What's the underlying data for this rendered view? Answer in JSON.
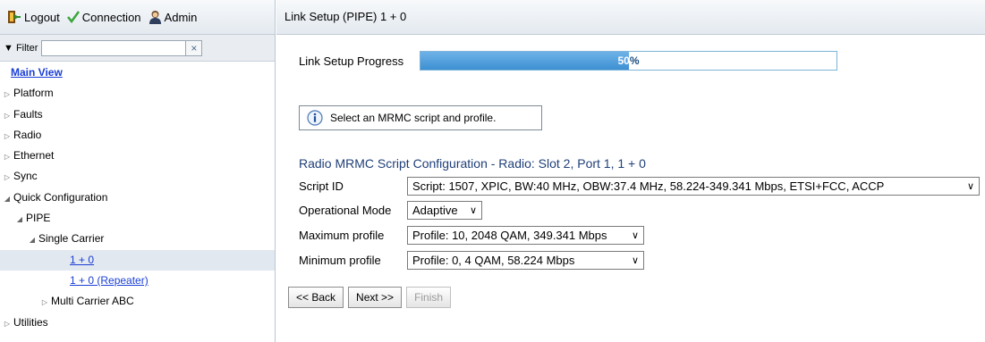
{
  "topbar": {
    "logout_label": "Logout",
    "connection_label": "Connection",
    "admin_label": "Admin"
  },
  "filter": {
    "label": "▼ Filter",
    "value": "",
    "clear_symbol": "×"
  },
  "tree": [
    {
      "label": "Main View",
      "type": "mainview"
    },
    {
      "label": "Platform",
      "arrow": "▷"
    },
    {
      "label": "Faults",
      "arrow": "▷"
    },
    {
      "label": "Radio",
      "arrow": "▷"
    },
    {
      "label": "Ethernet",
      "arrow": "▷"
    },
    {
      "label": "Sync",
      "arrow": "▷"
    },
    {
      "label": "Quick Configuration",
      "arrow": "◢"
    },
    {
      "label": "PIPE",
      "arrow": "◢"
    },
    {
      "label": "Single Carrier",
      "arrow": "◢"
    },
    {
      "label": "1 + 0",
      "type": "link",
      "selected": true
    },
    {
      "label": "1 + 0 (Repeater)",
      "type": "link"
    },
    {
      "label": "Multi Carrier ABC",
      "arrow": "▷"
    },
    {
      "label": "Utilities",
      "arrow": "▷"
    }
  ],
  "header": {
    "title": "Link Setup (PIPE) 1 + 0"
  },
  "progress": {
    "label": "Link Setup Progress",
    "value": 0.5,
    "text_number": "50",
    "text_unit": "%"
  },
  "info": {
    "message": "Select an MRMC script and profile."
  },
  "section": {
    "title": "Radio MRMC Script Configuration - Radio: Slot 2, Port 1, 1 + 0"
  },
  "form": {
    "script_id_label": "Script ID",
    "script_id_value": "Script: 1507, XPIC, BW:40 MHz, OBW:37.4 MHz, 58.224-349.341 Mbps, ETSI+FCC, ACCP",
    "operational_mode_label": "Operational Mode",
    "operational_mode_value": "Adaptive",
    "max_profile_label": "Maximum profile",
    "max_profile_value": "Profile: 10, 2048 QAM, 349.341 Mbps",
    "min_profile_label": "Minimum profile",
    "min_profile_value": "Profile: 0, 4 QAM, 58.224 Mbps"
  },
  "buttons": {
    "back_label": "<< Back",
    "next_label": "Next >>",
    "finish_label": "Finish"
  },
  "colors": {
    "link": "#1a3ed6",
    "section_title": "#1f3f78",
    "progress_fill": "#3d8fd2",
    "selected_row": "#e2e8ef"
  }
}
